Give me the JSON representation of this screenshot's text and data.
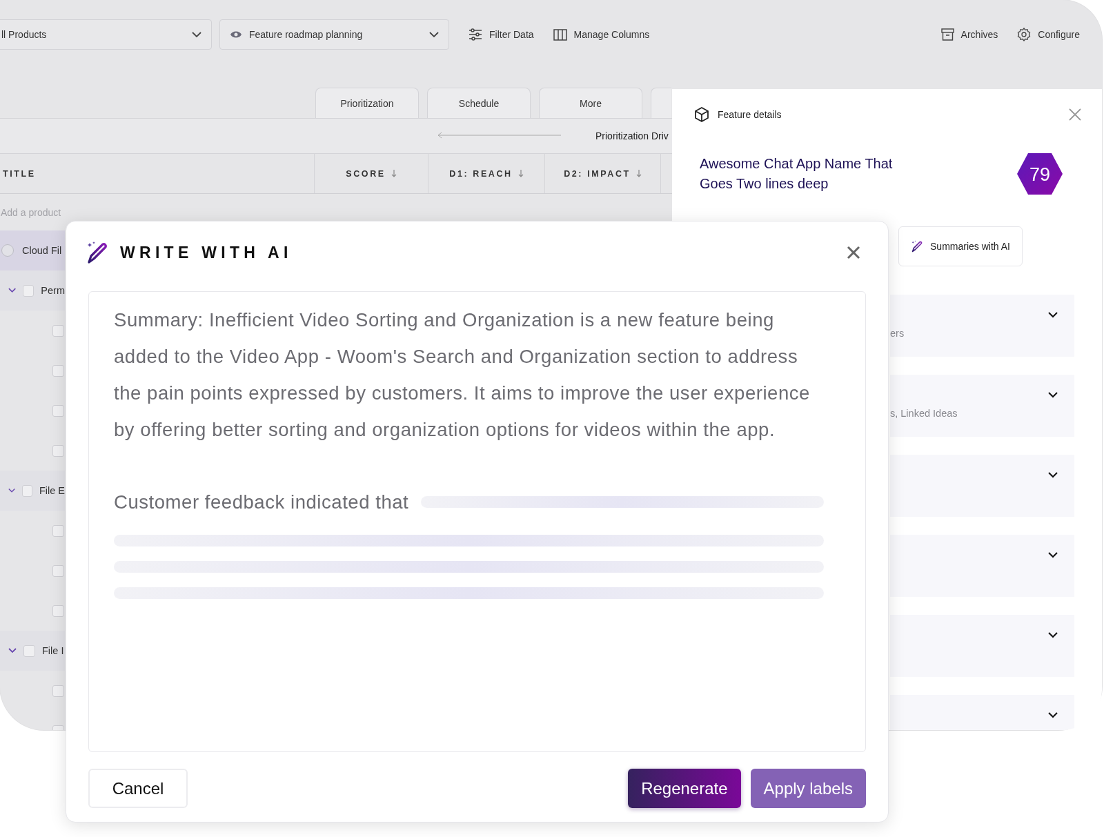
{
  "toolbar": {
    "product_filter": "ll Products",
    "view_select": "Feature roadmap planning",
    "actions": [
      {
        "label": "Filter Data"
      },
      {
        "label": "Manage Columns"
      }
    ],
    "right_actions": [
      {
        "label": "Archives"
      },
      {
        "label": "Configure"
      }
    ]
  },
  "tabs": [
    {
      "label": "Prioritization",
      "selected": false
    },
    {
      "label": "Schedule",
      "selected": false
    },
    {
      "label": "More",
      "selected": false
    }
  ],
  "group_header": "Prioritization Driv",
  "table": {
    "columns": [
      {
        "label": "TITLE",
        "sortable": false
      },
      {
        "label": "SCORE",
        "sortable": true
      },
      {
        "label": "D1: REACH",
        "sortable": true
      },
      {
        "label": "D2: IMPACT",
        "sortable": true
      }
    ],
    "add_placeholder": "Add a product",
    "rows": [
      {
        "title": "Cloud Fil",
        "kind": "product",
        "selected": true,
        "children": [
          {
            "title": "Perm",
            "expanded": true,
            "checked": false,
            "children": [
              {
                "checked": false
              },
              {
                "checked": false
              },
              {
                "checked": false
              },
              {
                "checked": false
              }
            ]
          },
          {
            "title": "File E",
            "expanded": true,
            "checked": false,
            "children": [
              {
                "checked": false
              },
              {
                "checked": false
              },
              {
                "checked": false
              }
            ]
          },
          {
            "title": "File I",
            "expanded": true,
            "checked": false,
            "children": [
              {
                "checked": false
              },
              {
                "checked": false
              }
            ]
          }
        ]
      }
    ]
  },
  "panel": {
    "title": "Feature details",
    "feature_name": "Awesome Chat App Name That Goes Two lines deep",
    "score": "79",
    "ai_button": "Summaries with AI",
    "sections": [
      {
        "subtitle": "ers",
        "expanded": false
      },
      {
        "subtitle": "s, Linked Ideas",
        "expanded": false
      },
      {
        "expanded": false
      },
      {
        "expanded": false
      },
      {
        "expanded": false
      },
      {
        "expanded": false
      }
    ]
  },
  "modal": {
    "title": "WRITE WITH AI",
    "summary": "Summary: Inefficient Video Sorting and Organization is a new feature being added to the Video App - Woom's Search and Organization section to address the pain points expressed by customers. It aims to improve the user experience by offering better sorting and organization options for videos within the app.",
    "partial_text": "Customer feedback indicated that",
    "loading": true,
    "buttons": [
      {
        "label": "Cancel",
        "kind": "secondary"
      },
      {
        "label": "Regenerate",
        "kind": "primary"
      },
      {
        "label": "Apply labels",
        "kind": "accent"
      }
    ]
  }
}
